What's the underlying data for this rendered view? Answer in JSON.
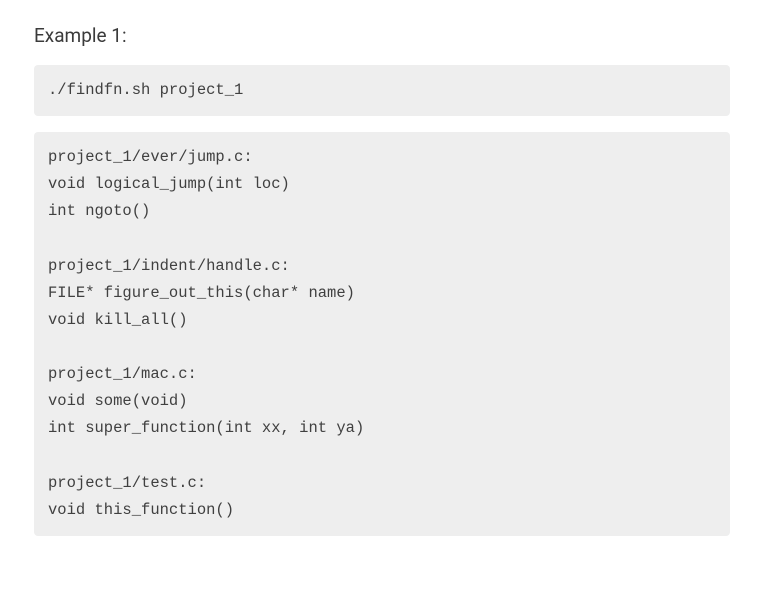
{
  "heading": "Example 1:",
  "command": "./findfn.sh project_1",
  "output": "project_1/ever/jump.c:\nvoid logical_jump(int loc)\nint ngoto()\n\nproject_1/indent/handle.c:\nFILE* figure_out_this(char* name)\nvoid kill_all()\n\nproject_1/mac.c:\nvoid some(void)\nint super_function(int xx, int ya)\n\nproject_1/test.c:\nvoid this_function()"
}
